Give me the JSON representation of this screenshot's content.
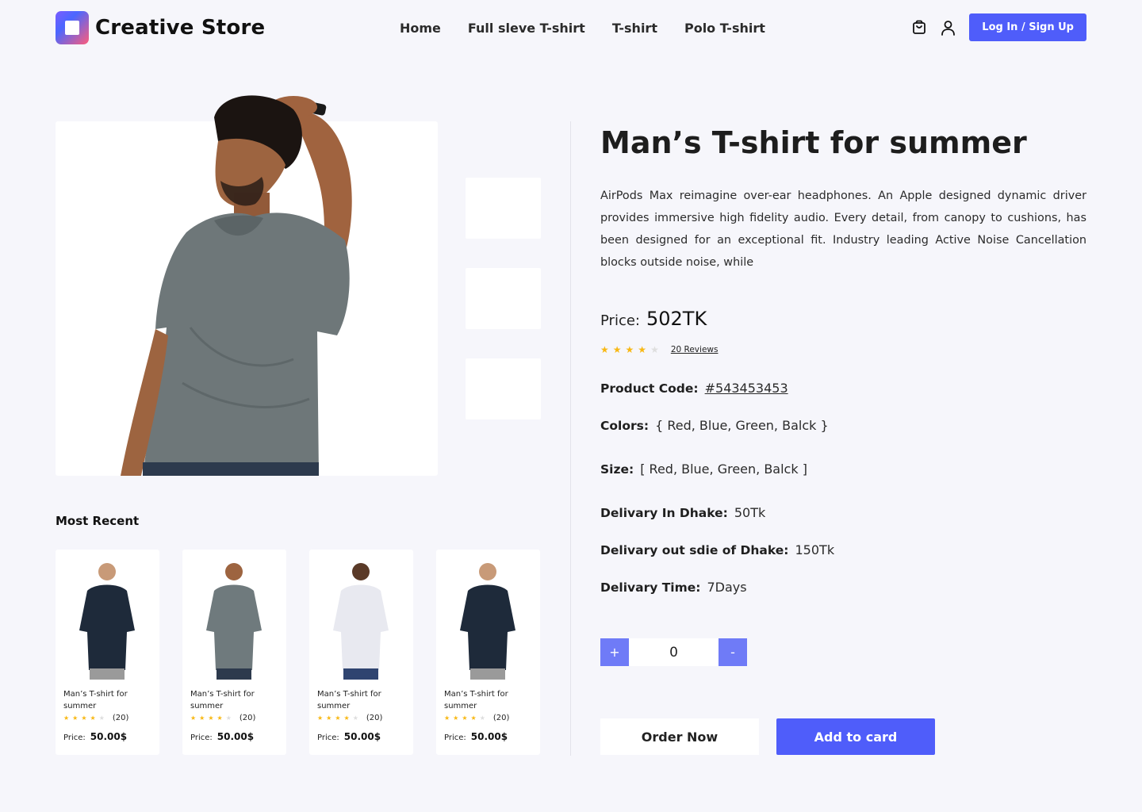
{
  "brand": {
    "name": "Creative Store"
  },
  "nav": {
    "items": [
      {
        "label": "Home"
      },
      {
        "label": "Full sleve T-shirt"
      },
      {
        "label": "T-shirt"
      },
      {
        "label": "Polo T-shirt"
      }
    ]
  },
  "header": {
    "login_label": "Log In / Sign Up"
  },
  "product": {
    "title": "Man’s T-shirt for summer",
    "description": "AirPods Max reimagine over-ear headphones. An Apple designed dynamic driver provides immersive high fidelity audio. Every detail, from canopy to cushions, has been designed for an exceptional fit. Industry leading Active Noise Cancellation blocks outside noise, while",
    "price_label": "Price:",
    "price": "502TK",
    "rating": 4,
    "rating_max": 5,
    "reviews_label": "20 Reviews",
    "code_label": "Product Code:",
    "code": "#543453453",
    "colors_label": "Colors:",
    "colors": "{ Red, Blue, Green, Balck }",
    "size_label": "Size:",
    "size": "[ Red, Blue, Green, Balck ]",
    "delivery_in_label": "Delivary In Dhake:",
    "delivery_in": "50Tk",
    "delivery_out_label": "Delivary out sdie of Dhake:",
    "delivery_out": "150Tk",
    "delivery_time_label": "Delivary Time:",
    "delivery_time": "7Days",
    "quantity": "0",
    "plus_label": "+",
    "minus_label": "-",
    "order_label": "Order Now",
    "add_label": "Add to card"
  },
  "recent": {
    "title": "Most Recent",
    "items": [
      {
        "name": "Man’s T-shirt for summer",
        "rating": 4,
        "count": "(20)",
        "price_label": "Price:",
        "price": "50.00$",
        "shirt_color": "#1e2a3a"
      },
      {
        "name": "Man’s T-shirt for summer",
        "rating": 4,
        "count": "(20)",
        "price_label": "Price:",
        "price": "50.00$",
        "shirt_color": "#6f7a7d"
      },
      {
        "name": "Man’s T-shirt for summer",
        "rating": 4,
        "count": "(20)",
        "price_label": "Price:",
        "price": "50.00$",
        "shirt_color": "#e8e9f0"
      },
      {
        "name": "Man’s T-shirt for summer",
        "rating": 4,
        "count": "(20)",
        "price_label": "Price:",
        "price": "50.00$",
        "shirt_color": "#1e2a3a"
      }
    ]
  },
  "colors": {
    "accent": "#4f5dfa",
    "star": "#f8b814",
    "background": "#f6f6fb"
  }
}
